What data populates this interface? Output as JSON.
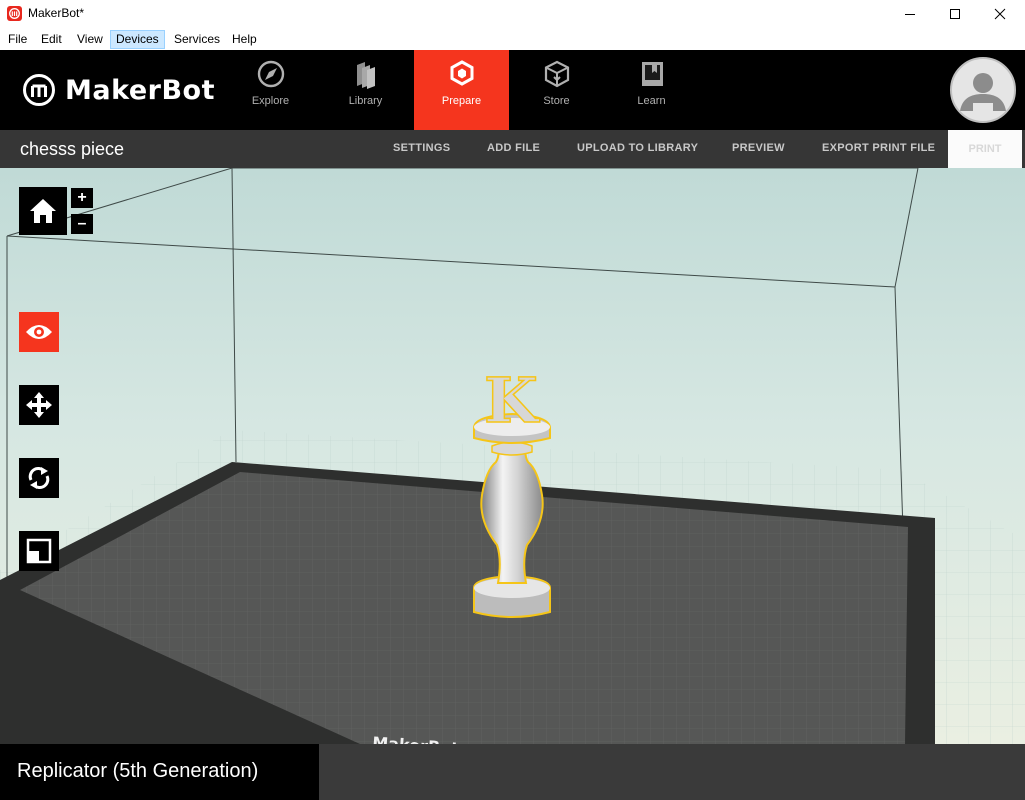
{
  "window": {
    "title": "MakerBot*",
    "controls": {
      "minimize": "minimize",
      "maximize": "maximize",
      "close": "close"
    }
  },
  "menubar": {
    "items": [
      {
        "label": "File"
      },
      {
        "label": "Edit"
      },
      {
        "label": "View"
      },
      {
        "label": "Devices",
        "active": true
      },
      {
        "label": "Services"
      },
      {
        "label": "Help"
      }
    ]
  },
  "nav": {
    "logo_text": "MakerBot",
    "tabs": [
      {
        "label": "Explore",
        "icon": "compass-icon"
      },
      {
        "label": "Library",
        "icon": "library-icon"
      },
      {
        "label": "Prepare",
        "icon": "prepare-cube-icon",
        "active": true
      },
      {
        "label": "Store",
        "icon": "store-box-icon"
      },
      {
        "label": "Learn",
        "icon": "learn-book-icon"
      }
    ],
    "avatar": "user-avatar-icon"
  },
  "subbar": {
    "project_title": "chesss piece",
    "actions": [
      "SETTINGS",
      "ADD FILE",
      "UPLOAD TO LIBRARY",
      "PREVIEW",
      "EXPORT PRINT FILE"
    ],
    "print_label": "PRINT"
  },
  "viewport": {
    "tools": [
      "home-icon",
      "eye-icon",
      "move-icon",
      "rotate-icon",
      "scale-icon"
    ],
    "zoom_in": "+",
    "zoom_out": "–",
    "model_letter": "K",
    "plate_label": "MakerBot"
  },
  "status": {
    "printer_name": "Replicator (5th Generation)"
  },
  "colors": {
    "accent": "#f5351e",
    "nav_bg": "#000000",
    "subbar_bg": "#363636",
    "selection": "#f5c518"
  }
}
